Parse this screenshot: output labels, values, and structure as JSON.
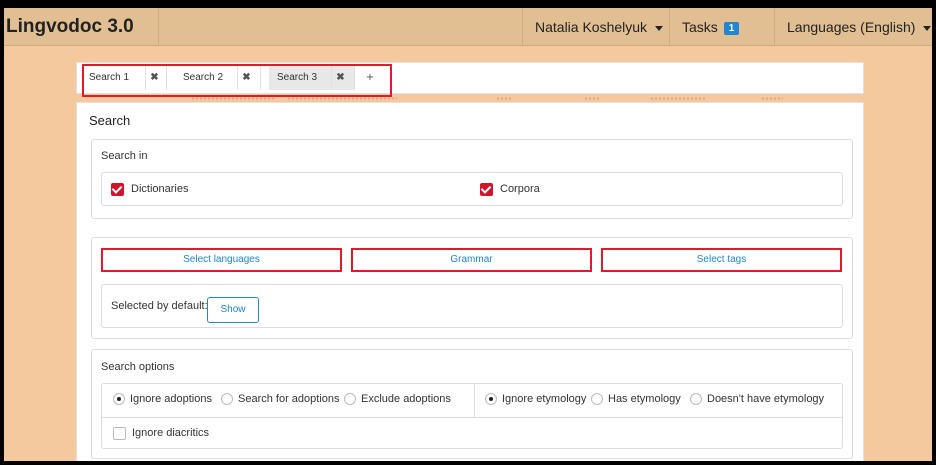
{
  "app": {
    "title": "Lingvodoc 3.0"
  },
  "header": {
    "user_label": "Natalia Koshelyuk",
    "tasks_label": "Tasks",
    "tasks_count": "1",
    "languages_label": "Languages (English)"
  },
  "tabs": [
    {
      "label": "Search 1",
      "close": "✖"
    },
    {
      "label": "Search 2",
      "close": "✖"
    },
    {
      "label": "Search 3",
      "close": "✖"
    }
  ],
  "add_tab_label": "+",
  "search": {
    "title": "Search",
    "search_in": {
      "title": "Search in",
      "dictionaries_label": "Dictionaries",
      "corpora_label": "Corpora"
    },
    "buttons": {
      "select_languages": "Select languages",
      "grammar": "Grammar",
      "select_tags": "Select tags"
    },
    "selected_by_default_label": "Selected by default:",
    "show_label": "Show",
    "options": {
      "title": "Search options",
      "adoptions": [
        "Ignore adoptions",
        "Search for adoptions",
        "Exclude adoptions"
      ],
      "etymology": [
        "Ignore etymology",
        "Has etymology",
        "Doesn't have etymology"
      ],
      "diacritics_label": "Ignore diacritics"
    }
  },
  "colors": {
    "header_bg": "#e2bf92",
    "page_bg": "#f3c99d",
    "accent": "#2185d0",
    "highlight": "#e0192b"
  }
}
